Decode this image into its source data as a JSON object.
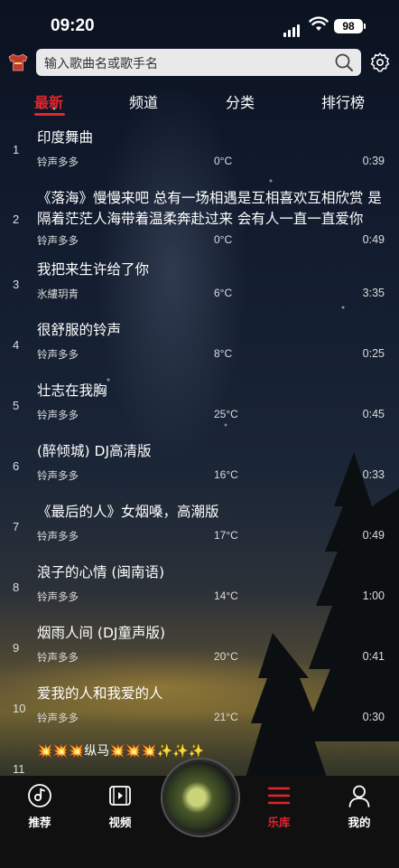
{
  "status": {
    "time": "09:20",
    "battery": "98"
  },
  "search": {
    "placeholder": "输入歌曲名或歌手名"
  },
  "tabs": [
    {
      "label": "最新",
      "active": true
    },
    {
      "label": "频道",
      "active": false
    },
    {
      "label": "分类",
      "active": false
    },
    {
      "label": "排行榜",
      "active": false
    }
  ],
  "songs": [
    {
      "index": "1",
      "title": "印度舞曲",
      "artist": "铃声多多",
      "temp": "0°C",
      "duration": "0:39"
    },
    {
      "index": "2",
      "title": "《落海》慢慢来吧 总有一场相遇是互相喜欢互相欣赏 是隔着茫茫人海带着温柔奔赴过来 会有人一直一直爱你",
      "artist": "铃声多多",
      "temp": "0°C",
      "duration": "0:49"
    },
    {
      "index": "3",
      "title": "我把来生许给了你",
      "artist": "氷縷玥青",
      "temp": "6°C",
      "duration": "3:35"
    },
    {
      "index": "4",
      "title": "很舒服的铃声",
      "artist": "铃声多多",
      "temp": "8°C",
      "duration": "0:25"
    },
    {
      "index": "5",
      "title": "壮志在我胸",
      "artist": "铃声多多",
      "temp": "25°C",
      "duration": "0:45"
    },
    {
      "index": "6",
      "title": "(醉倾城) DJ高清版",
      "artist": "铃声多多",
      "temp": "16°C",
      "duration": "0:33"
    },
    {
      "index": "7",
      "title": "《最后的人》女烟嗓，高潮版",
      "artist": "铃声多多",
      "temp": "17°C",
      "duration": "0:49"
    },
    {
      "index": "8",
      "title": "浪子的心情 (闽南语)",
      "artist": "铃声多多",
      "temp": "14°C",
      "duration": "1:00"
    },
    {
      "index": "9",
      "title": "烟雨人间 (DJ童声版)",
      "artist": "铃声多多",
      "temp": "20°C",
      "duration": "0:41"
    },
    {
      "index": "10",
      "title": "爱我的人和我爱的人",
      "artist": "铃声多多",
      "temp": "21°C",
      "duration": "0:30"
    },
    {
      "index": "11",
      "title": "💥💥💥纵马💥💥💥✨✨✨",
      "artist": "",
      "temp": "",
      "duration": ""
    }
  ],
  "nav": [
    {
      "label": "推荐",
      "icon": "recommend-disc-icon",
      "active": false
    },
    {
      "label": "视频",
      "icon": "video-icon",
      "active": false
    },
    {
      "label": "乐库",
      "icon": "library-icon",
      "active": true
    },
    {
      "label": "我的",
      "icon": "profile-icon",
      "active": false
    }
  ],
  "colors": {
    "accent": "#e0252c"
  }
}
